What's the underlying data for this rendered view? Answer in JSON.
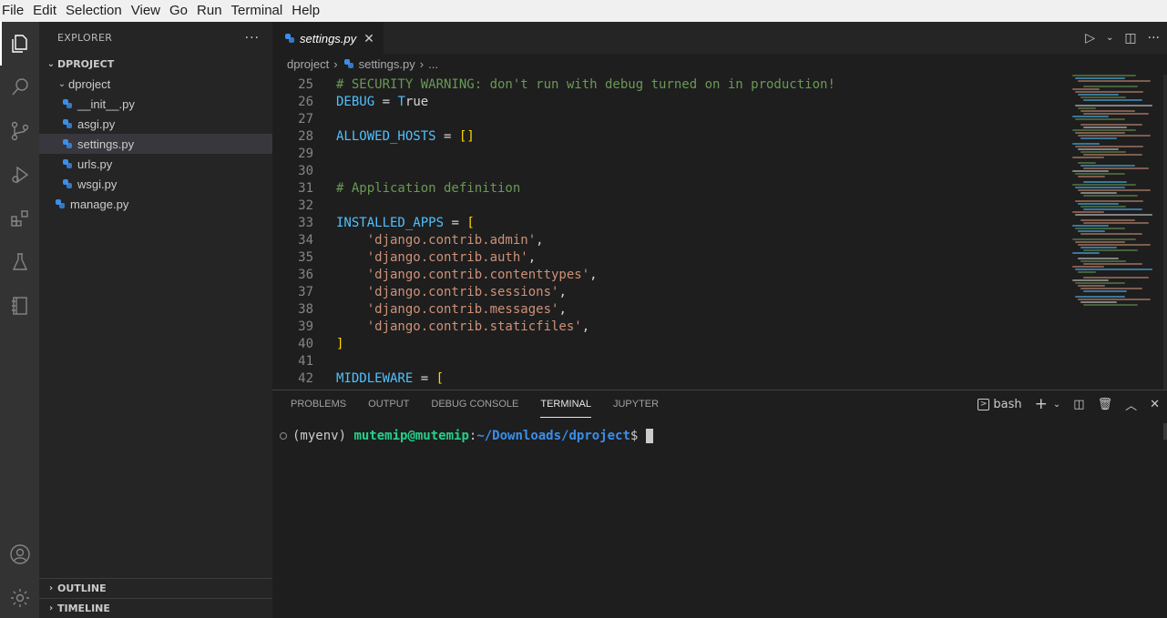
{
  "menubar": {
    "items": [
      "File",
      "Edit",
      "Selection",
      "View",
      "Go",
      "Run",
      "Terminal",
      "Help"
    ]
  },
  "activitybar": {
    "icons": [
      "explorer-icon",
      "search-icon",
      "source-control-icon",
      "run-debug-icon",
      "extensions-icon",
      "testing-icon",
      "notebook-icon",
      "account-icon",
      "settings-gear-icon"
    ]
  },
  "sidebar": {
    "title": "EXPLORER",
    "more_label": "···",
    "project": "DPROJECT",
    "folder": "dproject",
    "files": [
      "__init__.py",
      "asgi.py",
      "settings.py",
      "urls.py",
      "wsgi.py"
    ],
    "root_files": [
      "manage.py"
    ],
    "selected_file": "settings.py",
    "outline": "OUTLINE",
    "timeline": "TIMELINE"
  },
  "editor": {
    "tab_label": "settings.py",
    "tab_close": "✕",
    "breadcrumb": {
      "folder": "dproject",
      "file": "settings.py",
      "more": "..."
    },
    "lines": [
      {
        "n": "25",
        "text": "# SECURITY WARNING: don't run with debug turned on in production!"
      },
      {
        "n": "26",
        "text": "DEBUG = True"
      },
      {
        "n": "27",
        "text": ""
      },
      {
        "n": "28",
        "text": "ALLOWED_HOSTS = []"
      },
      {
        "n": "29",
        "text": ""
      },
      {
        "n": "30",
        "text": ""
      },
      {
        "n": "31",
        "text": "# Application definition"
      },
      {
        "n": "32",
        "text": ""
      },
      {
        "n": "33",
        "text": "INSTALLED_APPS = ["
      },
      {
        "n": "34",
        "text": "    'django.contrib.admin',"
      },
      {
        "n": "35",
        "text": "    'django.contrib.auth',"
      },
      {
        "n": "36",
        "text": "    'django.contrib.contenttypes',"
      },
      {
        "n": "37",
        "text": "    'django.contrib.sessions',"
      },
      {
        "n": "38",
        "text": "    'django.contrib.messages',"
      },
      {
        "n": "39",
        "text": "    'django.contrib.staticfiles',"
      },
      {
        "n": "40",
        "text": "]"
      },
      {
        "n": "41",
        "text": ""
      },
      {
        "n": "42",
        "text": "MIDDLEWARE = ["
      }
    ]
  },
  "panel": {
    "tabs": [
      "PROBLEMS",
      "OUTPUT",
      "DEBUG CONSOLE",
      "TERMINAL",
      "JUPYTER"
    ],
    "active_tab": "TERMINAL",
    "shell_label": "bash",
    "terminal": {
      "env": "(myenv) ",
      "user_host": "mutemip@mutemip",
      "colon": ":",
      "path": "~/Downloads/dproject",
      "dollar": "$"
    }
  },
  "colors": {
    "comment": "#6a9955",
    "variable": "#4fc1ff",
    "keyword": "#569cd6",
    "string": "#ce9178",
    "bracket": "#ffd700",
    "terminal_user": "#23d18b",
    "terminal_path": "#3b8eea"
  }
}
